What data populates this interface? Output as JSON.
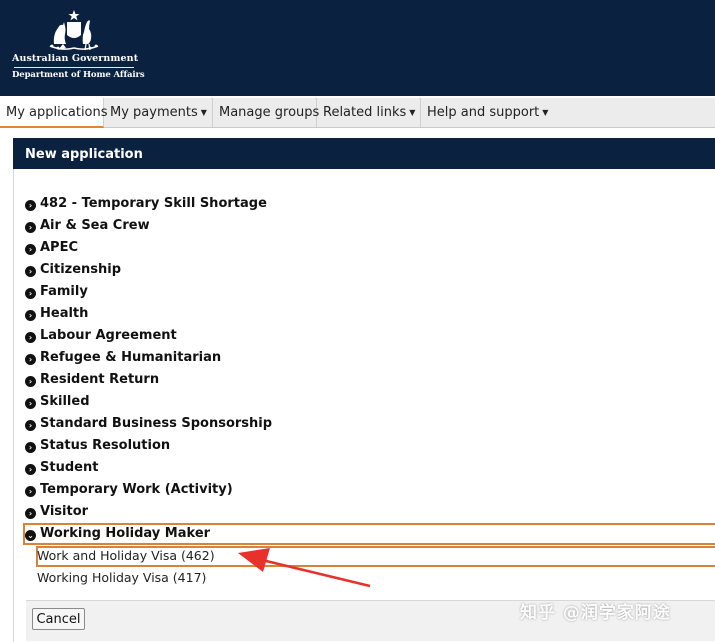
{
  "header": {
    "logo_line1": "Australian Government",
    "logo_line2": "Department of Home Affairs",
    "background": "#0b2140"
  },
  "nav": {
    "items": [
      {
        "label": "My applications",
        "dropdown": false,
        "active": true
      },
      {
        "label": "My payments",
        "dropdown": true,
        "active": false
      },
      {
        "label": "Manage groups",
        "dropdown": false,
        "active": false
      },
      {
        "label": "Related links",
        "dropdown": true,
        "active": false
      },
      {
        "label": "Help and support",
        "dropdown": true,
        "active": false
      }
    ],
    "caret": "▼"
  },
  "panel": {
    "title": "New application",
    "categories": [
      "482 - Temporary Skill Shortage",
      "Air & Sea Crew",
      "APEC",
      "Citizenship",
      "Family",
      "Health",
      "Labour Agreement",
      "Refugee & Humanitarian",
      "Resident Return",
      "Skilled",
      "Standard Business Sponsorship",
      "Status Resolution",
      "Student",
      "Temporary Work (Activity)",
      "Visitor",
      "Working Holiday Maker"
    ],
    "expanded_category": "Working Holiday Maker",
    "collapsed_icon": "›",
    "expanded_icon": "⌄",
    "subitems": [
      "Work and Holiday Visa (462)",
      "Working Holiday Visa (417)"
    ],
    "cancel_label": "Cancel"
  },
  "annotation": {
    "highlight_color": "#d8823a",
    "arrow_color": "#e8312a"
  },
  "watermark": "知乎 @润学家阿途",
  "colors": {
    "accent": "#e8842d",
    "nav_bg": "#ececec"
  }
}
